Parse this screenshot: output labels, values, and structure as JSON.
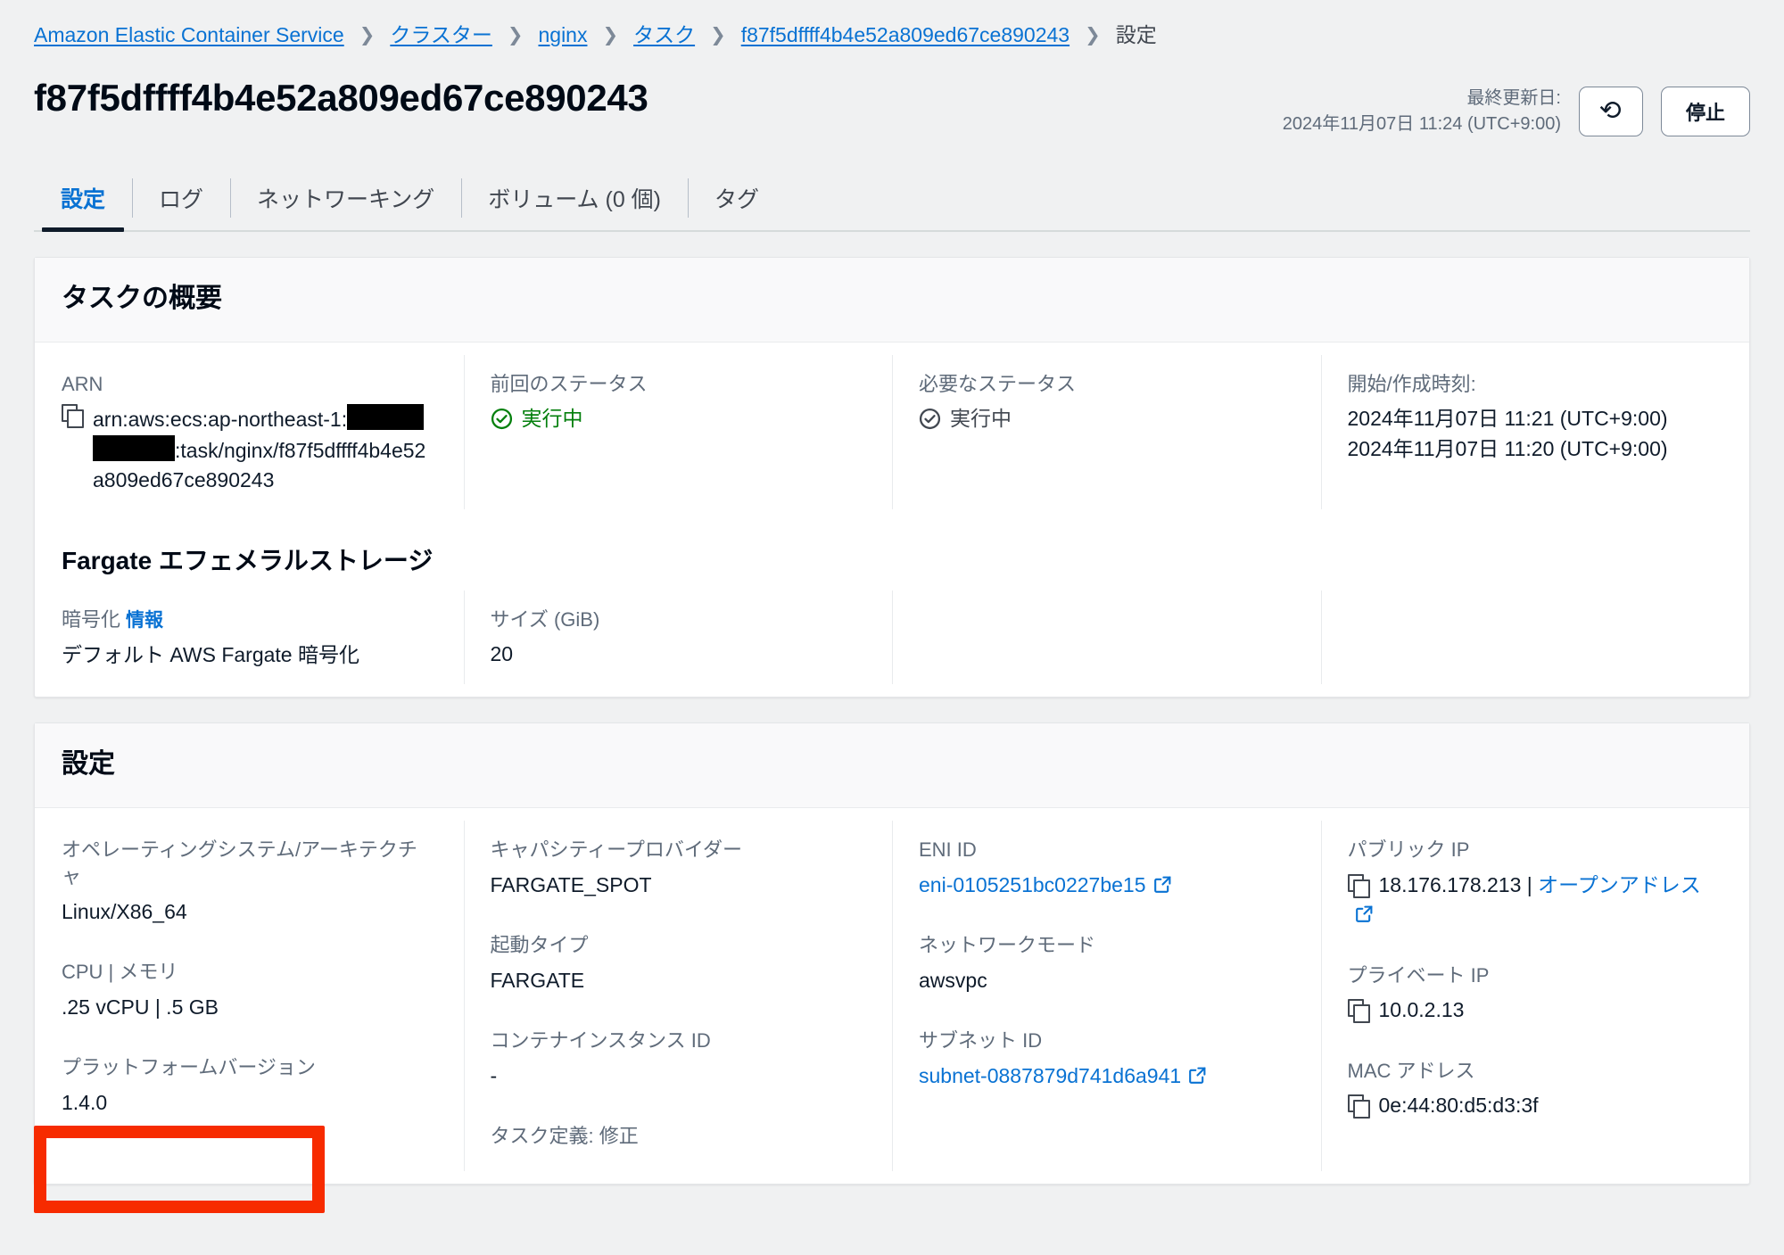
{
  "breadcrumb": {
    "items": [
      {
        "label": "Amazon Elastic Container Service",
        "type": "link"
      },
      {
        "label": "クラスター",
        "type": "link"
      },
      {
        "label": "nginx",
        "type": "link"
      },
      {
        "label": "タスク",
        "type": "link"
      },
      {
        "label": "f87f5dffff4b4e52a809ed67ce890243",
        "type": "link"
      },
      {
        "label": "設定",
        "type": "current"
      }
    ],
    "separator": "❯"
  },
  "header": {
    "title": "f87f5dffff4b4e52a809ed67ce890243",
    "last_updated_label": "最終更新日:",
    "last_updated_value": "2024年11月07日 11:24 (UTC+9:00)",
    "refresh_icon": "refresh-icon",
    "refresh_glyph": "⟳",
    "stop_label": "停止"
  },
  "tabs": [
    {
      "label": "設定",
      "active": true
    },
    {
      "label": "ログ",
      "active": false
    },
    {
      "label": "ネットワーキング",
      "active": false
    },
    {
      "label": "ボリューム (0 個)",
      "active": false
    },
    {
      "label": "タグ",
      "active": false
    }
  ],
  "overview": {
    "title": "タスクの概要",
    "arn": {
      "label": "ARN",
      "copy_icon": "copy-icon",
      "part1": "arn:aws:ecs:ap-northeast-1:",
      "part2": ":task/nginx/f87f5dffff4b4e52a",
      "part3": "809ed67ce890243"
    },
    "last_status": {
      "label": "前回のステータス",
      "value": "実行中",
      "icon": "status-success-icon",
      "color": "#037f0c"
    },
    "desired_status": {
      "label": "必要なステータス",
      "value": "実行中",
      "icon": "status-pending-icon",
      "color": "#414750"
    },
    "times": {
      "label": "開始/作成時刻:",
      "started": "2024年11月07日 11:21 (UTC+9:00)",
      "created": "2024年11月07日 11:20 (UTC+9:00)"
    },
    "fargate": {
      "title": "Fargate エフェメラルストレージ",
      "encryption_label": "暗号化",
      "encryption_info_link": "情報",
      "encryption_value": "デフォルト AWS Fargate 暗号化",
      "size_label": "サイズ (GiB)",
      "size_value": "20"
    }
  },
  "configuration": {
    "title": "設定",
    "col1": {
      "os_label": "オペレーティングシステム/アーキテクチャ",
      "os_value": "Linux/X86_64",
      "cpu_label": "CPU | メモリ",
      "cpu_value": ".25 vCPU | .5 GB",
      "platform_label": "プラットフォームバージョン",
      "platform_value": "1.4.0"
    },
    "col2": {
      "capacity_provider_label": "キャパシティープロバイダー",
      "capacity_provider_value": "FARGATE_SPOT",
      "launch_type_label": "起動タイプ",
      "launch_type_value": "FARGATE",
      "container_instance_label": "コンテナインスタンス ID",
      "container_instance_value": "-",
      "task_definition_label": "タスク定義: 修正"
    },
    "col3": {
      "eni_label": "ENI ID",
      "eni_value": "eni-0105251bc0227be15",
      "eni_icon": "external-link-icon",
      "network_mode_label": "ネットワークモード",
      "network_mode_value": "awsvpc",
      "subnet_label": "サブネット ID",
      "subnet_value": "subnet-0887879d741d6a941",
      "subnet_icon": "external-link-icon"
    },
    "col4": {
      "public_ip_label": "パブリック IP",
      "public_ip_value": "18.176.178.213",
      "public_ip_separator": "|",
      "open_address_label": "オープンアドレス",
      "open_address_icon": "external-link-icon",
      "private_ip_label": "プライベート IP",
      "private_ip_value": "10.0.2.13",
      "mac_label": "MAC アドレス",
      "mac_value": "0e:44:80:d5:d3:3f"
    }
  },
  "annotation": {
    "highlight_color": "#f72b00",
    "target": "プラットフォームバージョン 1.4.0"
  }
}
